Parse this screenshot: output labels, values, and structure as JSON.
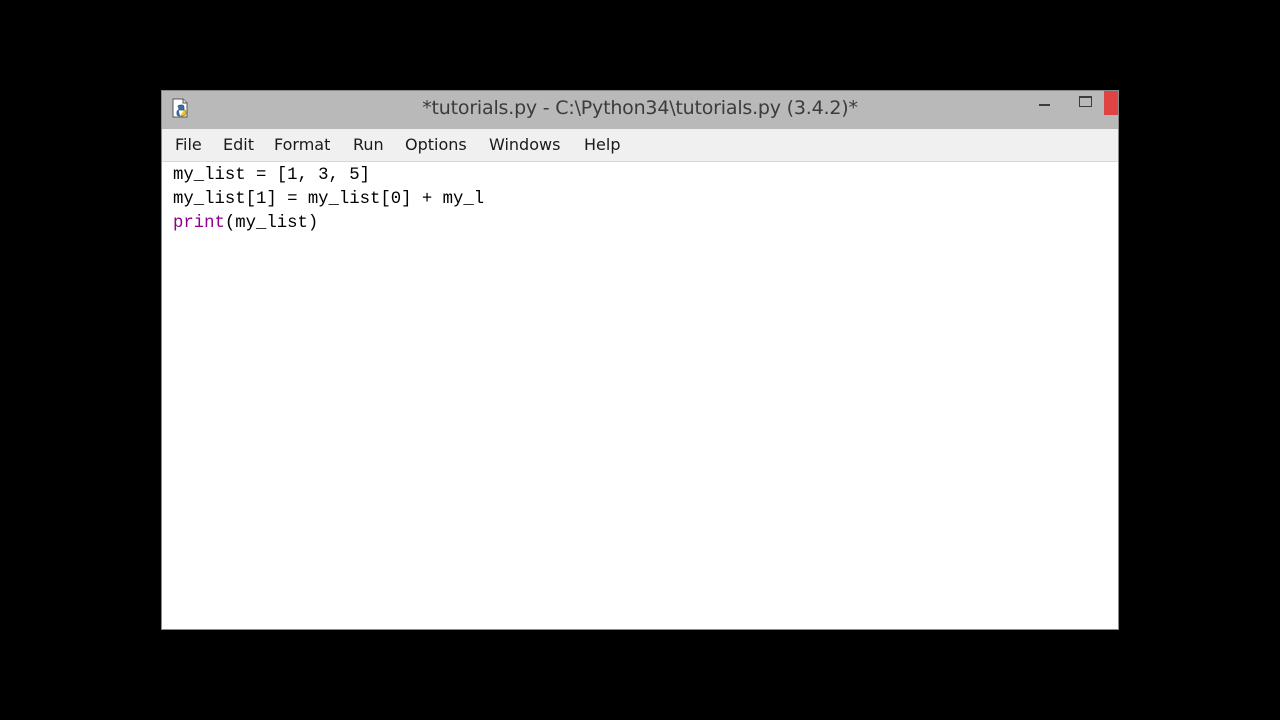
{
  "window": {
    "title": "*tutorials.py - C:\\Python34\\tutorials.py (3.4.2)*",
    "icon": "python-idle-icon",
    "controls": [
      "minimize-icon",
      "maximize-icon",
      "close-icon"
    ]
  },
  "menu": {
    "items": [
      "File",
      "Edit",
      "Format",
      "Run",
      "Options",
      "Windows",
      "Help"
    ]
  },
  "editor": {
    "lines": [
      "my_list = [1, 3, 5]",
      "my_list[1] = my_list[0] + my_l",
      "(my_list)"
    ],
    "line3_keyword": "print",
    "keyword_color": "#900090"
  }
}
